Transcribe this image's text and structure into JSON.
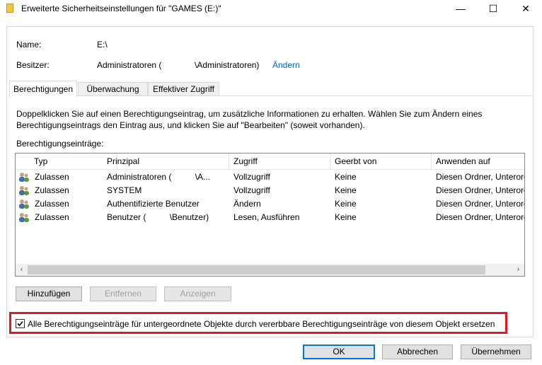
{
  "window": {
    "title": "Erweiterte Sicherheitseinstellungen für \"GAMES (E:)\"",
    "minimize": "—",
    "maximize": "☐",
    "close": "✕"
  },
  "info": {
    "name_label": "Name:",
    "name_value": "E:\\",
    "owner_label": "Besitzer:",
    "owner_value": "Administratoren (              \\Administratoren)",
    "owner_change_link": "Ändern"
  },
  "tabs": [
    {
      "label": "Berechtigungen",
      "active": true
    },
    {
      "label": "Überwachung",
      "active": false
    },
    {
      "label": "Effektiver Zugriff",
      "active": false
    }
  ],
  "description_line1": "Doppelklicken Sie auf einen Berechtigungseintrag, um zusätzliche Informationen zu erhalten. Wählen Sie zum Ändern eines",
  "description_line2": "Berechtigungseintrags den Eintrag aus, und klicken Sie auf \"Bearbeiten\" (soweit vorhanden).",
  "entries_label": "Berechtigungseinträge:",
  "table": {
    "columns": [
      "Typ",
      "Prinzipal",
      "Zugriff",
      "Geerbt von",
      "Anwenden auf"
    ],
    "rows": [
      [
        "Zulassen",
        "Administratoren (          \\A...",
        "Vollzugriff",
        "Keine",
        "Diesen Ordner, Unterordner und Dateien"
      ],
      [
        "Zulassen",
        "SYSTEM",
        "Vollzugriff",
        "Keine",
        "Diesen Ordner, Unterordner und Dateien"
      ],
      [
        "Zulassen",
        "Authentifizierte Benutzer",
        "Ändern",
        "Keine",
        "Diesen Ordner, Unterordner und Dateien"
      ],
      [
        "Zulassen",
        "Benutzer (          \\Benutzer)",
        "Lesen, Ausführen",
        "Keine",
        "Diesen Ordner, Unterordner und Dateien"
      ]
    ]
  },
  "scroll_left": "‹",
  "scroll_right": "›",
  "buttons": {
    "add": "Hinzufügen",
    "remove": "Entfernen",
    "view": "Anzeigen",
    "ok": "OK",
    "cancel": "Abbrechen",
    "apply": "Übernehmen"
  },
  "replace_checkbox": {
    "label": "Alle Berechtigungseinträge für untergeordnete Objekte durch vererbbare Berechtigungseinträge von diesem Objekt ersetzen",
    "checked": true
  },
  "colors": {
    "accent": "#0078d7",
    "highlight_border": "#e01a22",
    "link": "#0066cc"
  }
}
